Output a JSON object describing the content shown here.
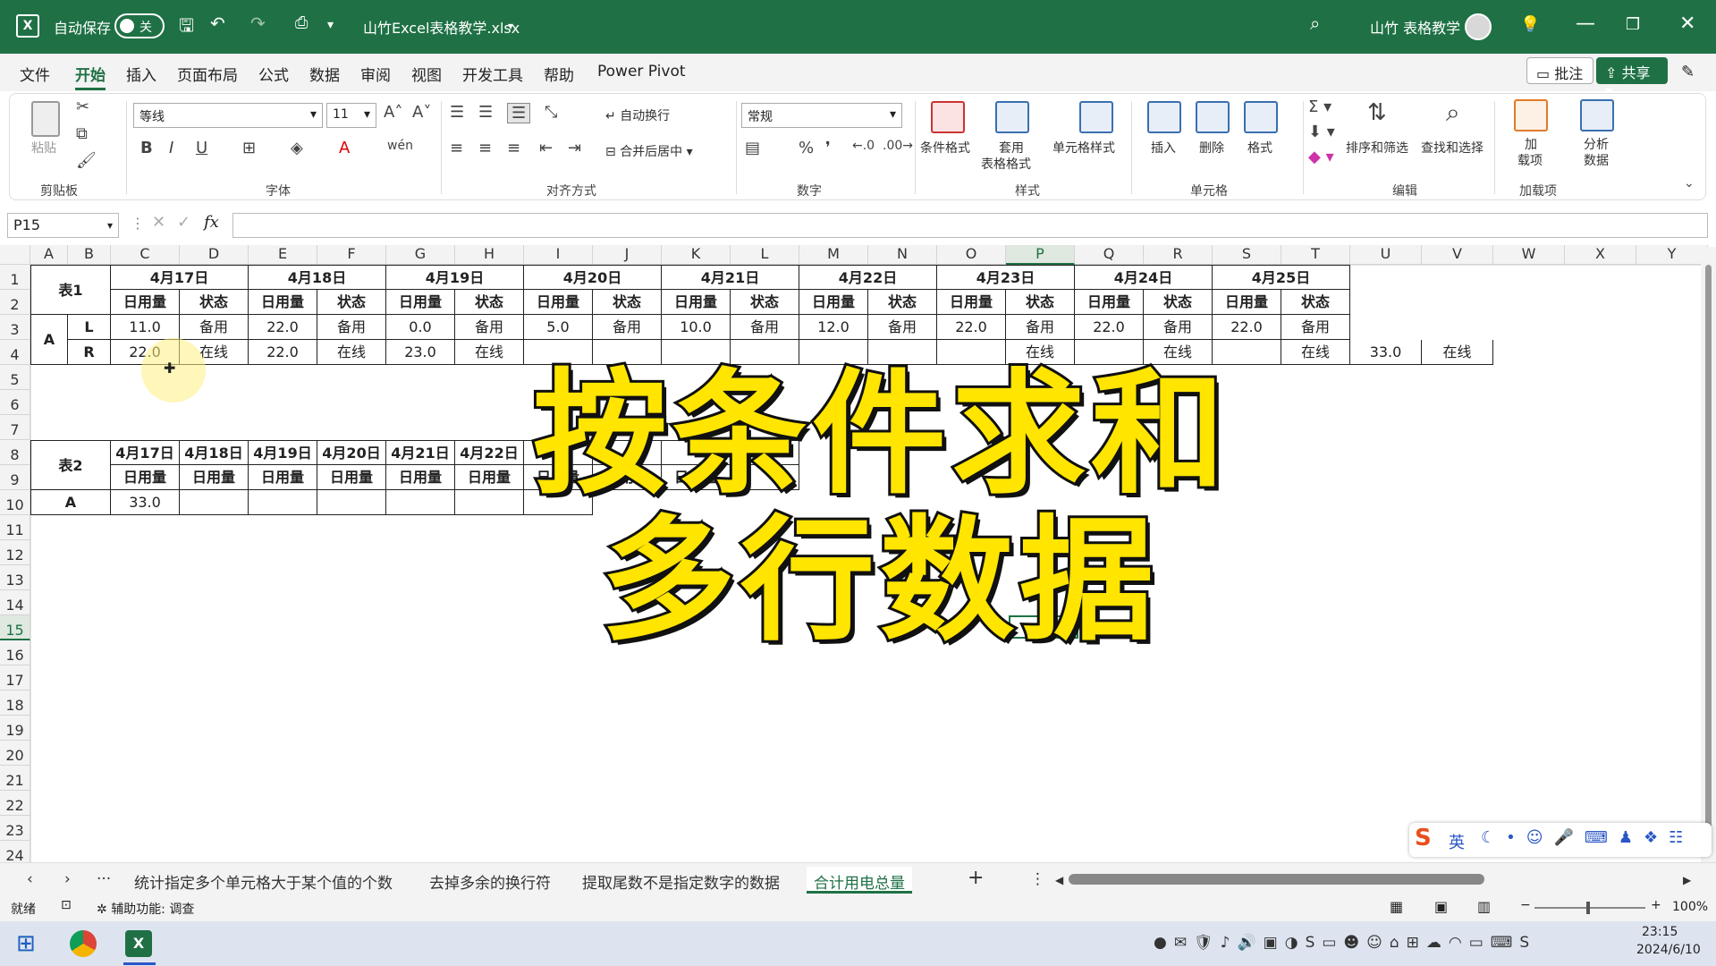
{
  "titlebar": {
    "autosave_label": "自动保存",
    "autosave_state": "关",
    "filename": "山竹Excel表格教学.xlsx",
    "user": "山竹 表格教学"
  },
  "menu": [
    "文件",
    "开始",
    "插入",
    "页面布局",
    "公式",
    "数据",
    "审阅",
    "视图",
    "开发工具",
    "帮助",
    "Power Pivot"
  ],
  "menu_active": "开始",
  "buttons": {
    "comment": "批注",
    "share": "共享"
  },
  "ribbon": {
    "clipboard": {
      "label": "剪贴板",
      "paste": "粘贴"
    },
    "font": {
      "label": "字体",
      "name": "等线",
      "size": "11"
    },
    "align": {
      "label": "对齐方式",
      "wrap": "自动换行",
      "merge": "合并后居中"
    },
    "number": {
      "label": "数字",
      "format": "常规"
    },
    "styles": {
      "label": "样式",
      "cond": "条件格式",
      "table1": "套用",
      "table2": "表格格式",
      "cell": "单元格样式"
    },
    "cells": {
      "label": "单元格",
      "insert": "插入",
      "delete": "删除",
      "format": "格式"
    },
    "edit": {
      "label": "编辑",
      "sort": "排序和筛选",
      "find": "查找和选择"
    },
    "addins": {
      "label": "加载项",
      "load1": "加",
      "load2": "载项",
      "analyze1": "分析",
      "analyze2": "数据"
    }
  },
  "namebox": "P15",
  "columns": [
    "A",
    "B",
    "C",
    "D",
    "E",
    "F",
    "G",
    "H",
    "I",
    "J",
    "K",
    "L",
    "M",
    "N",
    "O",
    "P",
    "Q",
    "R",
    "S",
    "T",
    "U",
    "V",
    "W",
    "X",
    "Y"
  ],
  "rows": [
    "1",
    "2",
    "3",
    "4",
    "5",
    "6",
    "7",
    "8",
    "9",
    "10",
    "11",
    "12",
    "13",
    "14",
    "15",
    "16",
    "17",
    "18",
    "19",
    "20",
    "21",
    "22",
    "23",
    "24"
  ],
  "table1": {
    "name": "表1",
    "dates": [
      "4月17日",
      "4月18日",
      "4月19日",
      "4月20日",
      "4月21日",
      "4月22日",
      "4月23日",
      "4月24日",
      "4月25日"
    ],
    "sub": [
      "日用量",
      "状态"
    ],
    "group": "A",
    "rows": [
      {
        "label": "L",
        "cells": [
          "11.0",
          "备用",
          "22.0",
          "备用",
          "0.0",
          "备用",
          "5.0",
          "备用",
          "10.0",
          "备用",
          "12.0",
          "备用",
          "22.0",
          "备用",
          "22.0",
          "备用",
          "22.0",
          "备用"
        ]
      },
      {
        "label": "R",
        "cells": [
          "22.0",
          "在线",
          "22.0",
          "在线",
          "23.0",
          "在线",
          "",
          "",
          "",
          "",
          "",
          "",
          "",
          "在线",
          "",
          "在线",
          "",
          "在线",
          "33.0",
          "在线"
        ]
      }
    ]
  },
  "table2": {
    "name": "表2",
    "dates": [
      "4月17日",
      "4月18日",
      "4月19日",
      "4月20日",
      "4月21日",
      "4月22日",
      "4",
      "",
      "",
      ""
    ],
    "sub": "日用量",
    "group": "A",
    "value": "33.0"
  },
  "overlay": {
    "line1": "按条件求和",
    "line2": "多行数据"
  },
  "sheets": [
    "统计指定多个单元格大于某个值的个数",
    "去掉多余的换行符",
    "提取尾数不是指定数字的数据",
    "合计用电总量"
  ],
  "active_sheet": "合计用电总量",
  "status": {
    "ready": "就绪",
    "accessibility": "辅助功能: 调查",
    "zoom": "100%"
  },
  "ime": {
    "lang": "英"
  },
  "clock": {
    "time": "23:15",
    "date": "2024/6/10"
  }
}
